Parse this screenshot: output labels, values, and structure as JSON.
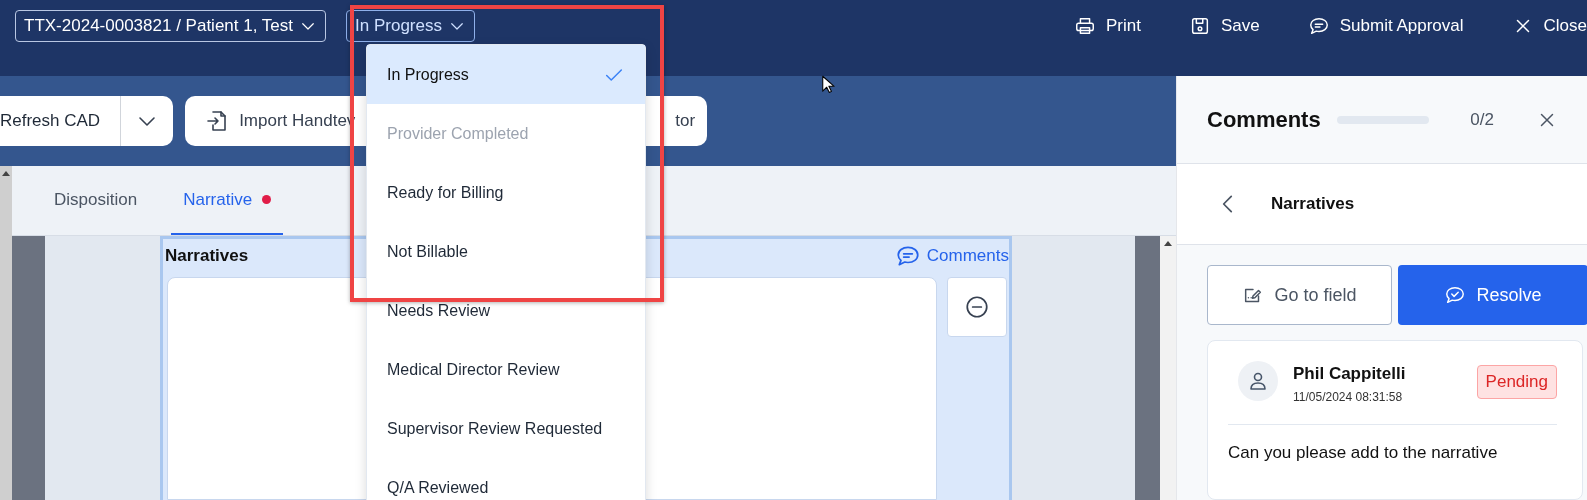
{
  "header": {
    "record_selector": "TTX-2024-0003821 / Patient 1, Test",
    "status_selector": "In Progress",
    "actions": [
      {
        "label": "Print"
      },
      {
        "label": "Save"
      },
      {
        "label": "Submit Approval"
      },
      {
        "label": "Close"
      }
    ]
  },
  "status_menu": [
    {
      "label": "In Progress",
      "selected": true,
      "disabled": false
    },
    {
      "label": "Provider Completed",
      "selected": false,
      "disabled": true
    },
    {
      "label": "Ready for Billing",
      "selected": false,
      "disabled": false
    },
    {
      "label": "Not Billable",
      "selected": false,
      "disabled": false
    },
    {
      "label": "Needs Review",
      "selected": false,
      "disabled": false
    },
    {
      "label": "Medical Director Review",
      "selected": false,
      "disabled": false
    },
    {
      "label": "Supervisor Review Requested",
      "selected": false,
      "disabled": false
    },
    {
      "label": "Q/A Reviewed",
      "selected": false,
      "disabled": false
    }
  ],
  "toolbar": {
    "refresh_button": "Refresh CAD",
    "import_button": "Import Handtev",
    "monitor_button": "tor"
  },
  "tabs": [
    {
      "label": "Disposition",
      "selected": false,
      "alert": false
    },
    {
      "label": "Narrative",
      "selected": true,
      "alert": true
    }
  ],
  "section": {
    "title": "Narratives",
    "comments_link": "Comments"
  },
  "comments_panel": {
    "title": "Comments",
    "progress": {
      "level": 0
    },
    "count": "0/2",
    "back_label": "Narratives",
    "buttons": [
      {
        "label": "Go to field",
        "kind": "secondary"
      },
      {
        "label": "Resolve",
        "kind": "primary"
      }
    ],
    "comment": {
      "author": "Phil Cappitelli",
      "timestamp": "11/05/2024 08:31:58",
      "status": "Pending",
      "text": "Can you please add to the narrative"
    }
  }
}
